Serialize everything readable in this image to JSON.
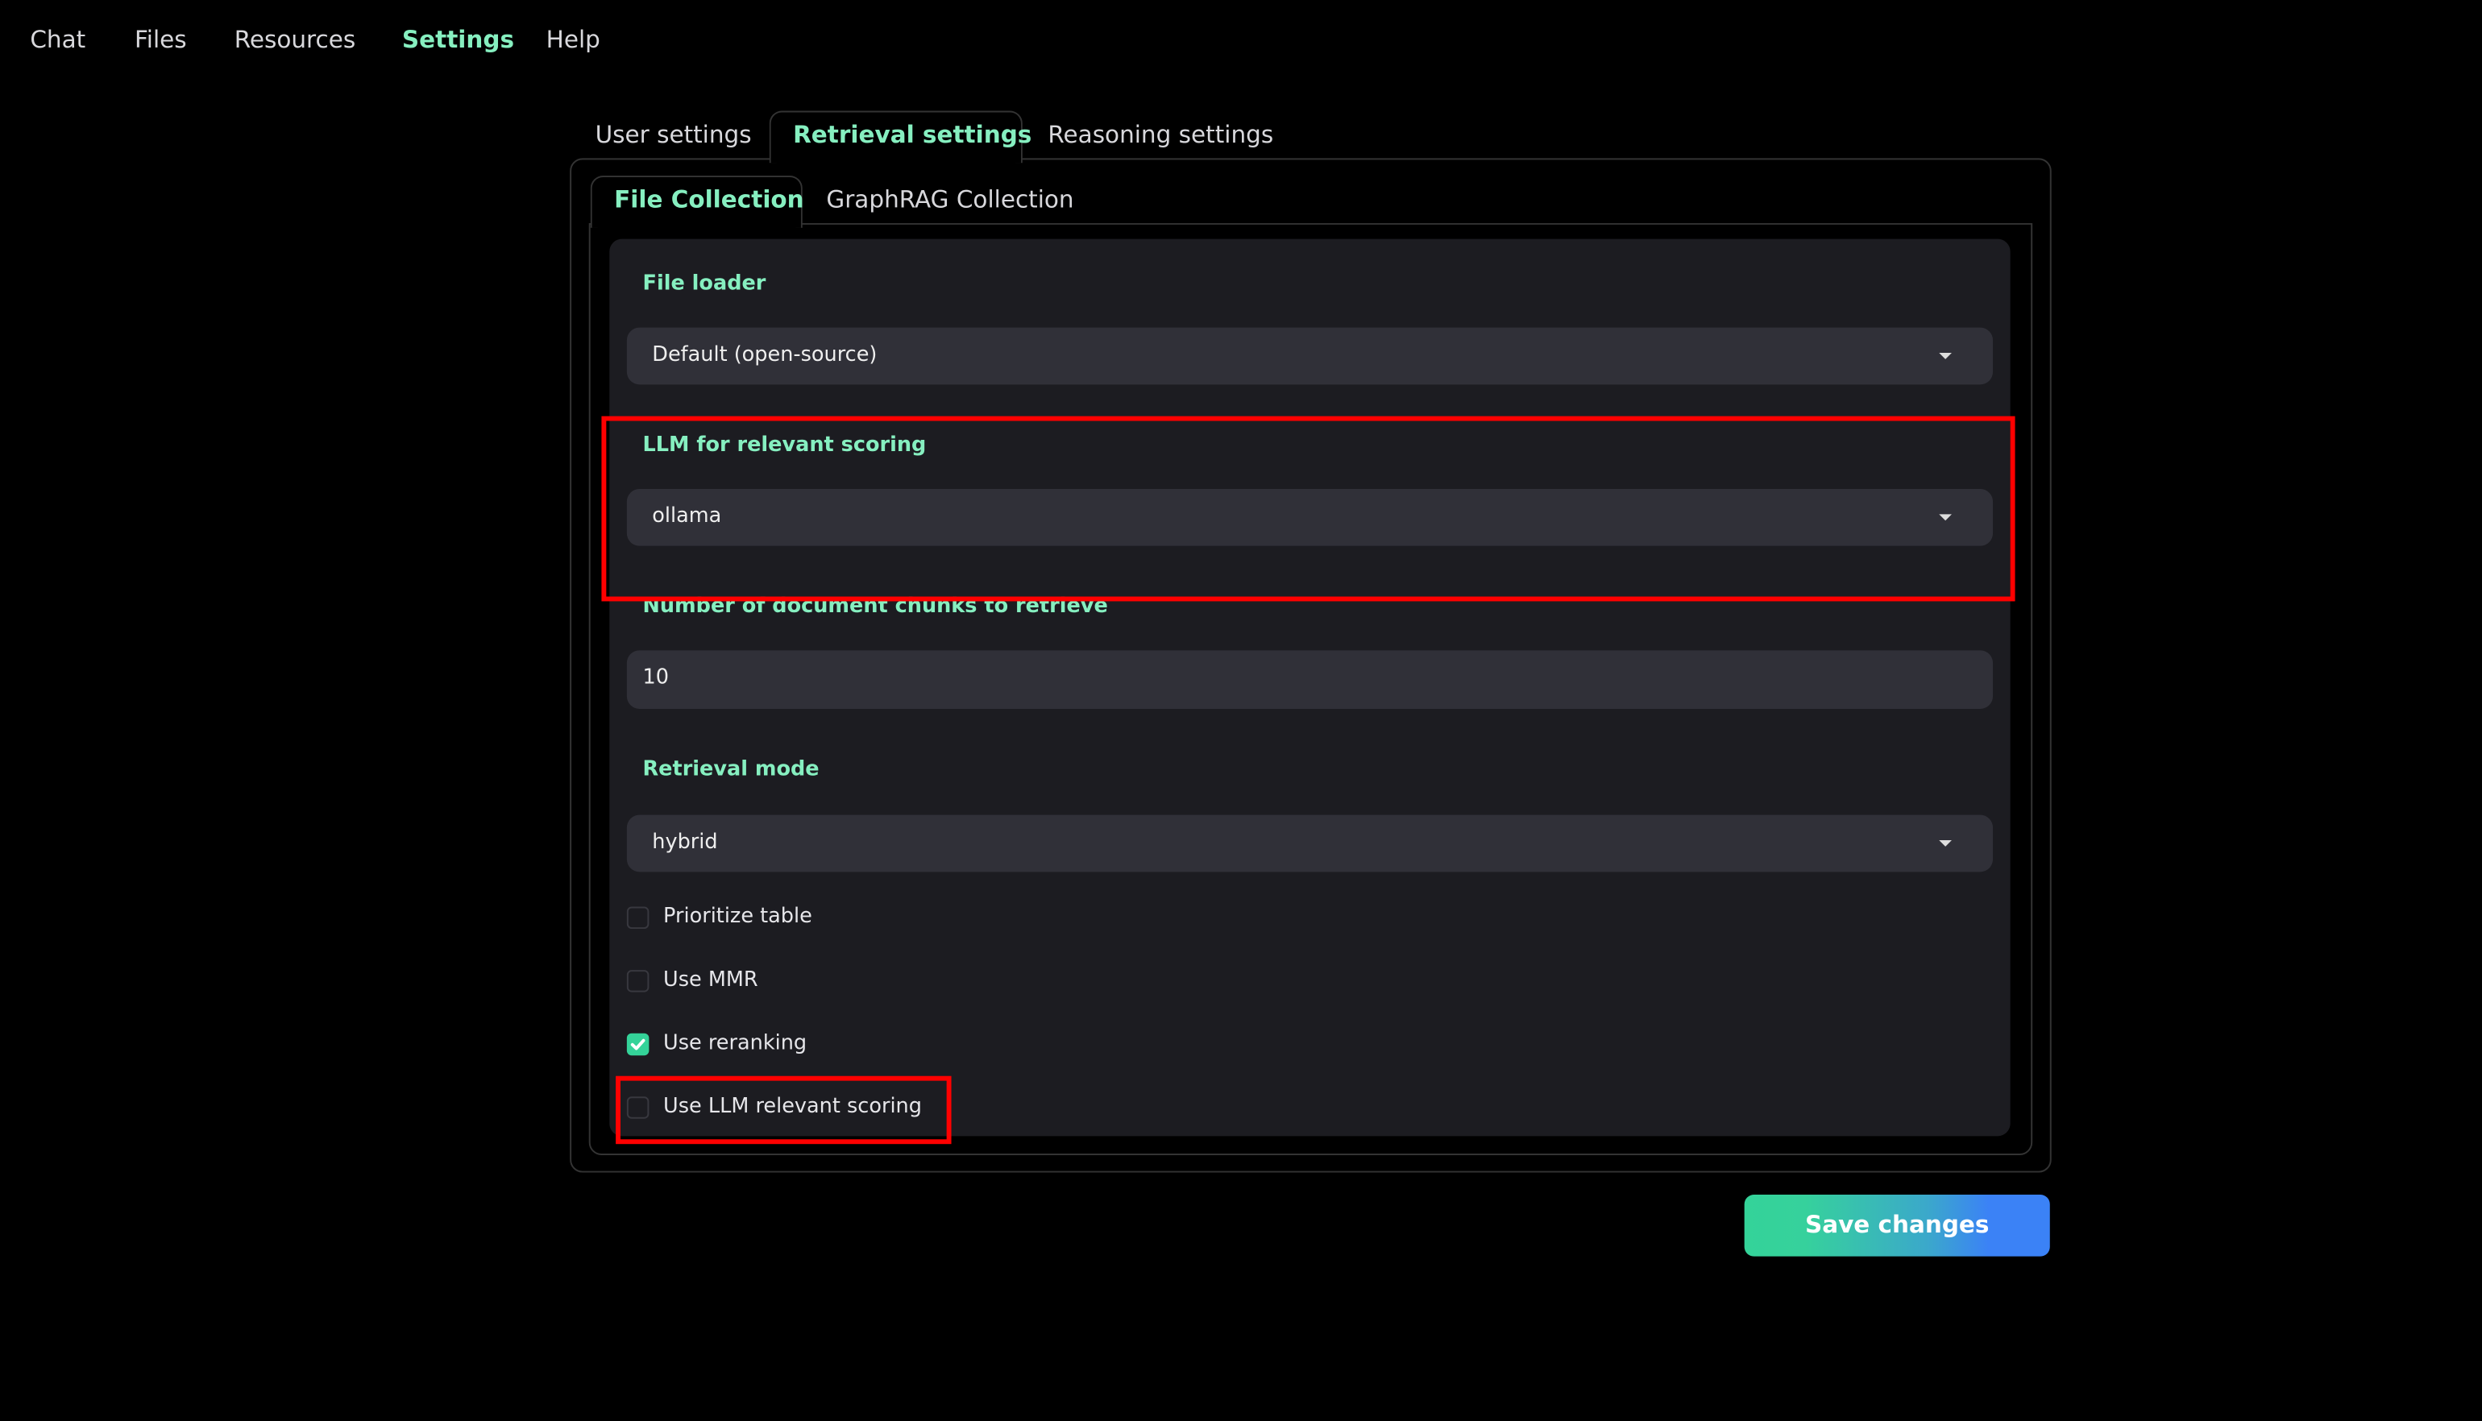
{
  "nav": {
    "items": [
      {
        "label": "Chat",
        "active": false
      },
      {
        "label": "Files",
        "active": false
      },
      {
        "label": "Resources",
        "active": false
      },
      {
        "label": "Settings",
        "active": true
      },
      {
        "label": "Help",
        "active": false
      }
    ]
  },
  "settings_tabs": [
    {
      "label": "User settings",
      "active": false
    },
    {
      "label": "Retrieval settings",
      "active": true
    },
    {
      "label": "Reasoning settings",
      "active": false
    }
  ],
  "collection_tabs": [
    {
      "label": "File Collection",
      "active": true
    },
    {
      "label": "GraphRAG Collection",
      "active": false
    }
  ],
  "form": {
    "file_loader": {
      "label": "File loader",
      "value": "Default (open-source)"
    },
    "llm_scoring": {
      "label": "LLM for relevant scoring",
      "value": "ollama"
    },
    "num_chunks": {
      "label": "Number of document chunks to retrieve",
      "value": "10"
    },
    "retrieval_mode": {
      "label": "Retrieval mode",
      "value": "hybrid"
    },
    "checkboxes": [
      {
        "label": "Prioritize table",
        "checked": false
      },
      {
        "label": "Use MMR",
        "checked": false
      },
      {
        "label": "Use reranking",
        "checked": true
      },
      {
        "label": "Use LLM relevant scoring",
        "checked": false
      }
    ]
  },
  "save_label": "Save changes",
  "colors": {
    "accent": "#86efc0",
    "checkbox_on": "#34d399",
    "gradient_start": "#34d399",
    "gradient_end": "#3b82f6",
    "highlight": "#ff0000"
  }
}
